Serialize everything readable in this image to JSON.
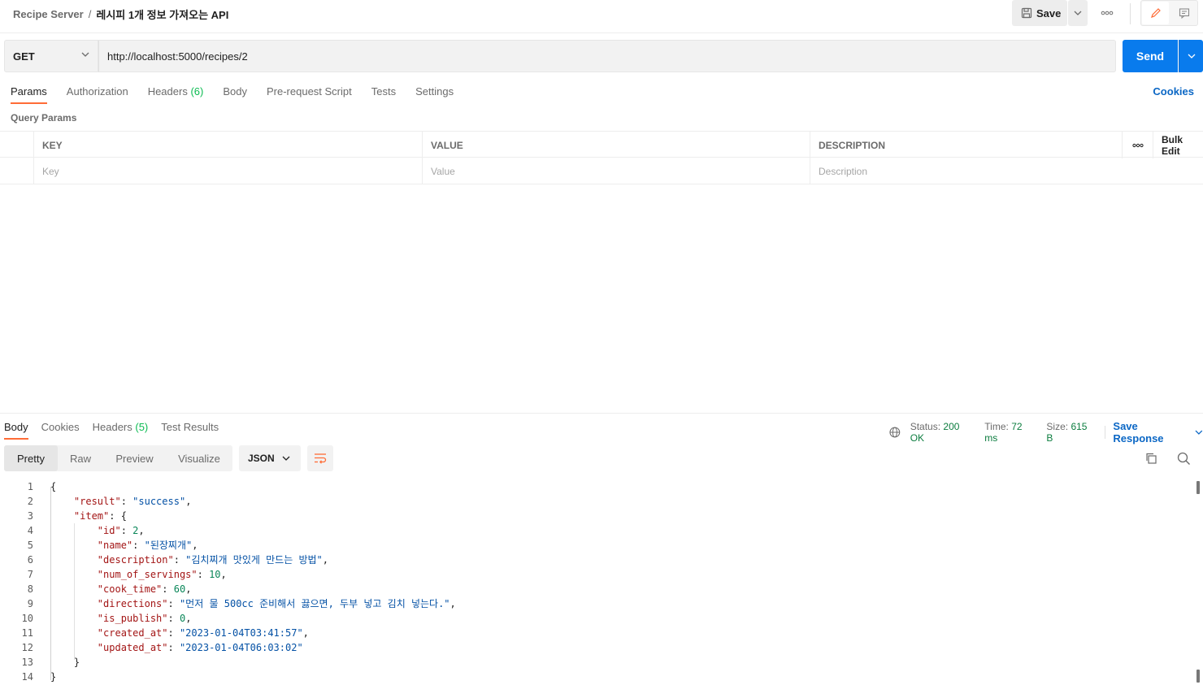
{
  "header": {
    "breadcrumb_parent": "Recipe Server",
    "breadcrumb_sep": "/",
    "breadcrumb_current": "레시피 1개 정보 가져오는 API",
    "save_label": "Save"
  },
  "request": {
    "method": "GET",
    "url": "http://localhost:5000/recipes/2",
    "send_label": "Send"
  },
  "req_tabs": {
    "params": "Params",
    "authorization": "Authorization",
    "headers": "Headers",
    "headers_count": "(6)",
    "body": "Body",
    "pre_request": "Pre-request Script",
    "tests": "Tests",
    "settings": "Settings",
    "cookies": "Cookies"
  },
  "query_params": {
    "label": "Query Params",
    "col_key": "KEY",
    "col_value": "VALUE",
    "col_description": "DESCRIPTION",
    "bulk_edit": "Bulk Edit",
    "placeholder_key": "Key",
    "placeholder_value": "Value",
    "placeholder_description": "Description"
  },
  "response": {
    "tabs": {
      "body": "Body",
      "cookies": "Cookies",
      "headers": "Headers",
      "headers_count": "(5)",
      "test_results": "Test Results"
    },
    "status_label": "Status:",
    "status_value": "200 OK",
    "time_label": "Time:",
    "time_value": "72 ms",
    "size_label": "Size:",
    "size_value": "615 B",
    "save_response": "Save Response",
    "views": {
      "pretty": "Pretty",
      "raw": "Raw",
      "preview": "Preview",
      "visualize": "Visualize"
    },
    "format": "JSON"
  },
  "code": {
    "line_numbers": [
      "1",
      "2",
      "3",
      "4",
      "5",
      "6",
      "7",
      "8",
      "9",
      "10",
      "11",
      "12",
      "13",
      "14"
    ],
    "open_brace": "{",
    "close_brace": "}",
    "k_result": "\"result\"",
    "v_result": "\"success\"",
    "k_item": "\"item\"",
    "k_id": "\"id\"",
    "v_id": "2",
    "k_name": "\"name\"",
    "v_name": "\"된장찌개\"",
    "k_description": "\"description\"",
    "v_description": "\"김치찌개 맛있게 만드는 방법\"",
    "k_num_of_servings": "\"num_of_servings\"",
    "v_num_of_servings": "10",
    "k_cook_time": "\"cook_time\"",
    "v_cook_time": "60",
    "k_directions": "\"directions\"",
    "v_directions": "\"먼저 물 500cc 준비해서 끓으면, 두부 넣고 김치 넣는다.\"",
    "k_is_publish": "\"is_publish\"",
    "v_is_publish": "0",
    "k_created_at": "\"created_at\"",
    "v_created_at": "\"2023-01-04T03:41:57\"",
    "k_updated_at": "\"updated_at\"",
    "v_updated_at": "\"2023-01-04T06:03:02\""
  },
  "colors": {
    "accent": "#ff6c37",
    "send": "#097bed",
    "link": "#0b67c5",
    "status_ok": "#0c7d3f"
  }
}
